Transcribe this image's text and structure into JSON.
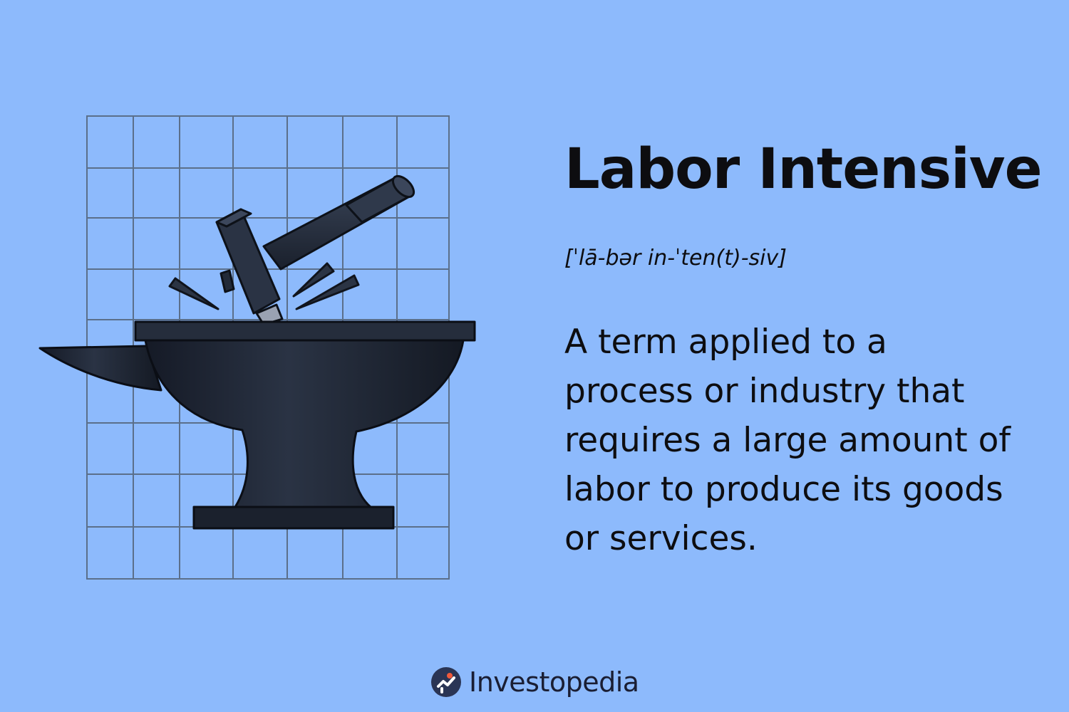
{
  "colors": {
    "background": "#8dbafc",
    "grid": "#5b6f8a",
    "anvil": "#1f2533",
    "text": "#0d0d10",
    "brand_text": "#1a1e33"
  },
  "illustration": {
    "icons": [
      "grid-paper",
      "anvil-icon",
      "hammer-icon",
      "spark-icon"
    ]
  },
  "term": {
    "title": "Labor Intensive",
    "pronunciation": "[ˈlā-bər in-ˈten(t)-siv]",
    "definition_lines": [
      "A term applied to a",
      "process or industry that",
      "requires a large amount of",
      "labor to produce its goods",
      "or services."
    ]
  },
  "brand": {
    "name": "Investopedia",
    "icon": "investopedia-logo-icon"
  }
}
